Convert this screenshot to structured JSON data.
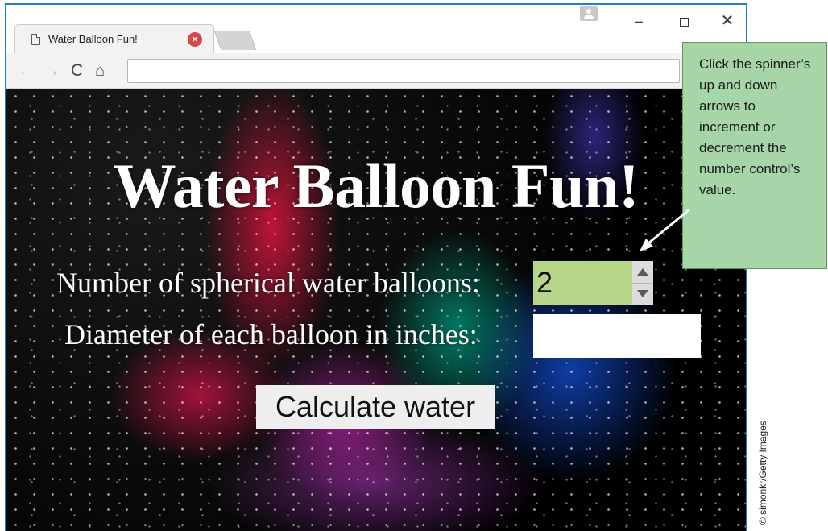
{
  "browser": {
    "tab_title": "Water Balloon Fun!",
    "tab_close_icon": "close-circle-icon",
    "address_bar_value": "",
    "nav": {
      "back_glyph": "←",
      "forward_glyph": "→",
      "reload_glyph": "C",
      "home_glyph": "⌂"
    },
    "window_controls": {
      "minimize": "–",
      "close": "✕"
    }
  },
  "page": {
    "heading": "Water Balloon Fun!",
    "count_label": "Number of spherical water balloons:",
    "count_value": "2",
    "diameter_label": "Diameter of each balloon in inches:",
    "diameter_value": "",
    "calculate_label": "Calculate water"
  },
  "callout": {
    "text": "Click the spinner’s up and down arrows to increment or decrement the number control’s value."
  },
  "credit": "© simonkr/Getty Images",
  "colors": {
    "window_border": "#1e7fc4",
    "spinner_fill": "#b8d68a",
    "callout_fill": "#a8d5a8"
  }
}
